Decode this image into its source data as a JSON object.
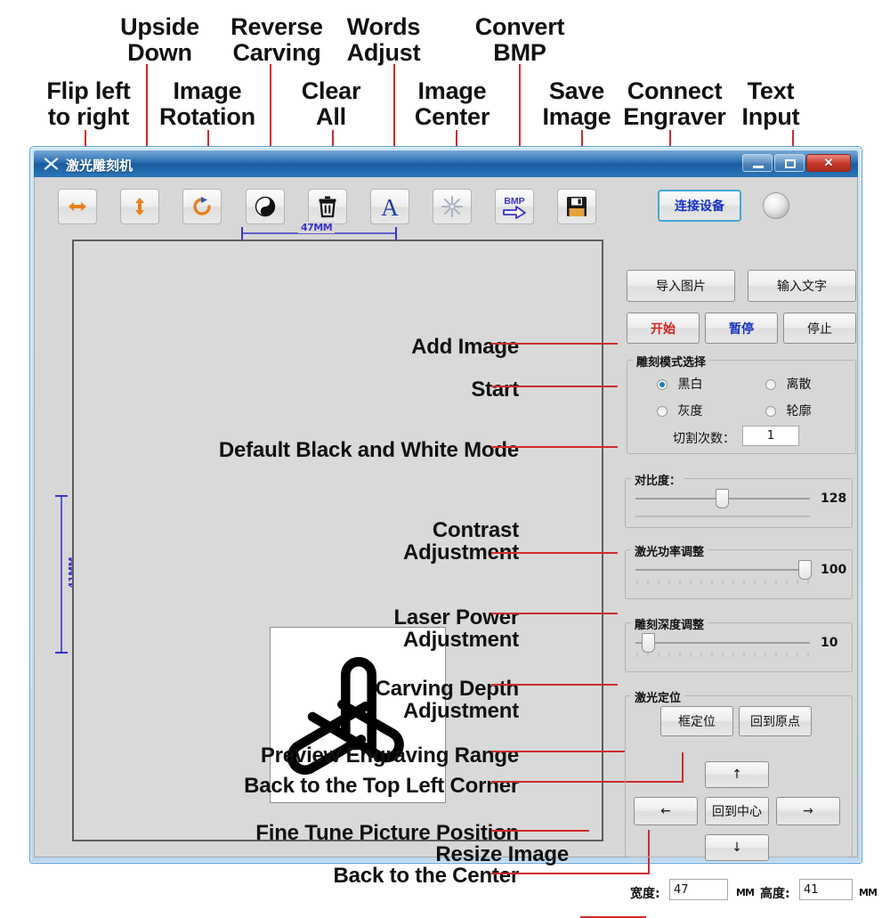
{
  "annotations_top": [
    {
      "id": "flip-left-to-right",
      "text": "Flip left\nto right"
    },
    {
      "id": "upside-down",
      "text": "Upside\nDown"
    },
    {
      "id": "image-rotation",
      "text": "Image\nRotation"
    },
    {
      "id": "reverse-carving",
      "text": "Reverse\nCarving"
    },
    {
      "id": "clear-all",
      "text": "Clear\nAll"
    },
    {
      "id": "words-adjust",
      "text": "Words\nAdjust"
    },
    {
      "id": "image-center",
      "text": "Image\nCenter"
    },
    {
      "id": "convert-bmp",
      "text": "Convert\nBMP"
    },
    {
      "id": "save-image",
      "text": "Save\nImage"
    },
    {
      "id": "connect-engraver",
      "text": "Connect\nEngraver"
    },
    {
      "id": "text-input",
      "text": "Text\nInput"
    }
  ],
  "annotations_inner": [
    {
      "id": "add-image",
      "text": "Add Image"
    },
    {
      "id": "start",
      "text": "Start"
    },
    {
      "id": "default-bw-mode",
      "text": "Default Black and White Mode"
    },
    {
      "id": "contrast-adjustment",
      "text": "Contrast\nAdjustment"
    },
    {
      "id": "laser-power-adjustment",
      "text": "Laser Power\nAdjustment"
    },
    {
      "id": "carving-depth-adjustment",
      "text": "Carving Depth\nAdjustment"
    },
    {
      "id": "preview-engraving-range",
      "text": "Preview Engraving Range"
    },
    {
      "id": "back-to-top-left-corner",
      "text": "Back to the Top Left Corner"
    },
    {
      "id": "fine-tune-picture-position",
      "text": "Fine Tune Picture Position"
    },
    {
      "id": "back-to-the-center",
      "text": "Back to the Center"
    },
    {
      "id": "resize-image",
      "text": "Resize Image"
    }
  ],
  "window": {
    "title": "激光雕刻机",
    "minimize_label": "",
    "maximize_label": "",
    "close_label": "✕"
  },
  "toolbar": {
    "buttons": [
      {
        "name": "flip-horizontal-icon",
        "tip": "Flip left to right"
      },
      {
        "name": "flip-vertical-icon",
        "tip": "Upside Down"
      },
      {
        "name": "rotate-icon",
        "tip": "Image Rotation"
      },
      {
        "name": "invert-icon",
        "tip": "Reverse Carving"
      },
      {
        "name": "trash-icon",
        "tip": "Clear All"
      },
      {
        "name": "text-letter-icon",
        "tip": "Words Adjust"
      },
      {
        "name": "center-star-icon",
        "tip": "Image Center"
      },
      {
        "name": "bmp-convert-icon",
        "tip": "Convert BMP"
      },
      {
        "name": "floppy-save-icon",
        "tip": "Save Image"
      }
    ],
    "connect_label": "连接设备"
  },
  "rulers": {
    "horizontal": "47MM",
    "vertical": "41MM"
  },
  "panel": {
    "import_image_label": "导入图片",
    "text_input_label": "输入文字",
    "start_label": "开始",
    "pause_label": "暂停",
    "stop_label": "停止",
    "mode_group_title": "雕刻模式选择",
    "modes": [
      {
        "label": "黑白",
        "selected": true
      },
      {
        "label": "离散",
        "selected": false
      },
      {
        "label": "灰度",
        "selected": false
      },
      {
        "label": "轮廓",
        "selected": false
      }
    ],
    "cut_count_label": "切割次数：",
    "cut_count_value": "1",
    "sliders": [
      {
        "title": "对比度：",
        "value": "128",
        "pct": 46
      },
      {
        "title": "激光功率调整",
        "value": "100",
        "pct": 98
      },
      {
        "title": "雕刻深度调整",
        "value": "10",
        "pct": 10
      }
    ],
    "position_group_title": "激光定位",
    "frame_locate_label": "框定位",
    "back_origin_label": "回到原点",
    "arrow_up_label": "↑",
    "arrow_left_label": "←",
    "back_center_label": "回到中心",
    "arrow_right_label": "→",
    "arrow_down_label": "↓",
    "width_label": "宽度:",
    "width_value": "47",
    "width_unit": "MM",
    "height_label": "高度:",
    "height_value": "41",
    "height_unit": "MM"
  },
  "colors": {
    "leader_red": "#cf2b2b",
    "ruler_blue": "#3b33c9",
    "accent_cyan": "#3fa9d8",
    "titlebar_blue": "#1f66ac",
    "start_red": "#d21f1f",
    "pause_blue": "#1433c2"
  }
}
